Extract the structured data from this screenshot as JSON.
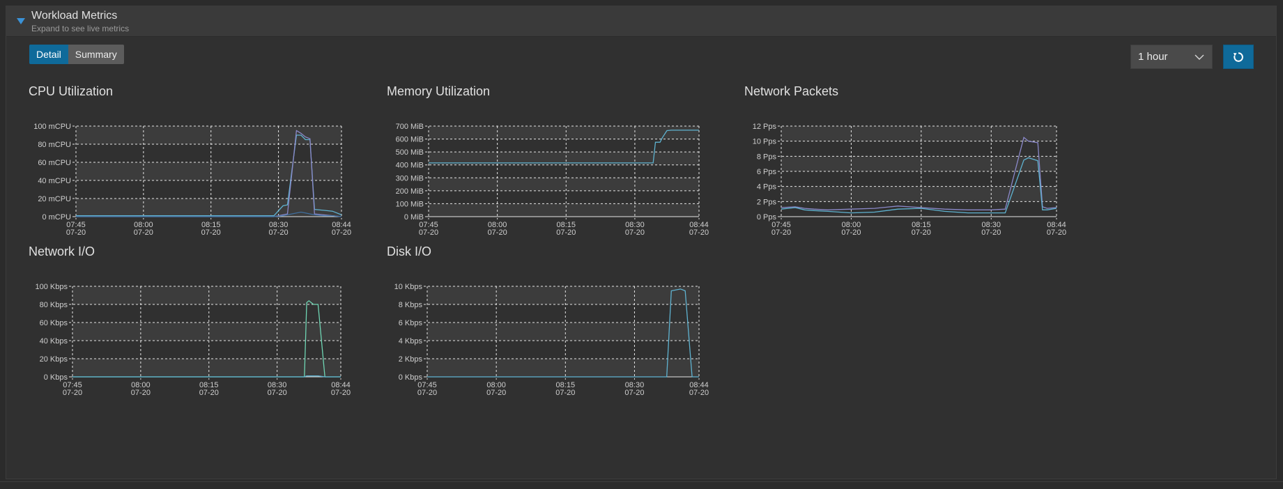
{
  "panel": {
    "title": "Workload Metrics",
    "subtitle": "Expand to see live metrics"
  },
  "view_toggle": {
    "detail": "Detail",
    "summary": "Summary"
  },
  "range_select": {
    "value": "1 hour"
  },
  "icons": {
    "caret": "caret-down-icon",
    "chevron": "chevron-down-icon",
    "refresh": "refresh-icon"
  },
  "colors": {
    "accent": "#0f6a9a",
    "series_blue": "#5fb3d1",
    "series_green": "#6fd6b4",
    "series_purple": "#8a88c8"
  },
  "charts": [
    {
      "title": "CPU Utilization",
      "yticks": [
        "100 mCPU",
        "80 mCPU",
        "60 mCPU",
        "40 mCPU",
        "20 mCPU",
        "0 mCPU"
      ],
      "xticks": [
        [
          "07:45",
          "07-20"
        ],
        [
          "08:00",
          "07-20"
        ],
        [
          "08:15",
          "07-20"
        ],
        [
          "08:30",
          "07-20"
        ],
        [
          "08:44",
          "07-20"
        ]
      ]
    },
    {
      "title": "Memory Utilization",
      "yticks": [
        "700 MiB",
        "600 MiB",
        "500 MiB",
        "400 MiB",
        "300 MiB",
        "200 MiB",
        "100 MiB",
        "0 MiB"
      ],
      "xticks": [
        [
          "07:45",
          "07-20"
        ],
        [
          "08:00",
          "07-20"
        ],
        [
          "08:15",
          "07-20"
        ],
        [
          "08:30",
          "07-20"
        ],
        [
          "08:44",
          "07-20"
        ]
      ]
    },
    {
      "title": "Network Packets",
      "yticks": [
        "12 Pps",
        "10 Pps",
        "8 Pps",
        "6 Pps",
        "4 Pps",
        "2 Pps",
        "0 Pps"
      ],
      "xticks": [
        [
          "07:45",
          "07-20"
        ],
        [
          "08:00",
          "07-20"
        ],
        [
          "08:15",
          "07-20"
        ],
        [
          "08:30",
          "07-20"
        ],
        [
          "08:44",
          "07-20"
        ]
      ]
    },
    {
      "title": "Network I/O",
      "yticks": [
        "100 Kbps",
        "80 Kbps",
        "60 Kbps",
        "40 Kbps",
        "20 Kbps",
        "0 Kbps"
      ],
      "xticks": [
        [
          "07:45",
          "07-20"
        ],
        [
          "08:00",
          "07-20"
        ],
        [
          "08:15",
          "07-20"
        ],
        [
          "08:30",
          "07-20"
        ],
        [
          "08:44",
          "07-20"
        ]
      ]
    },
    {
      "title": "Disk I/O",
      "yticks": [
        "10 Kbps",
        "8 Kbps",
        "6 Kbps",
        "4 Kbps",
        "2 Kbps",
        "0 Kbps"
      ],
      "xticks": [
        [
          "07:45",
          "07-20"
        ],
        [
          "08:00",
          "07-20"
        ],
        [
          "08:15",
          "07-20"
        ],
        [
          "08:30",
          "07-20"
        ],
        [
          "08:44",
          "07-20"
        ]
      ]
    }
  ],
  "chart_data": [
    {
      "type": "line",
      "title": "CPU Utilization",
      "x_minutes": [
        0,
        10,
        20,
        30,
        40,
        44,
        46,
        47,
        49,
        50,
        51,
        52,
        53,
        55,
        57,
        59
      ],
      "xtick_labels": [
        "07:45 07-20",
        "08:00 07-20",
        "08:15 07-20",
        "08:30 07-20",
        "08:44 07-20"
      ],
      "ylim": [
        0,
        100
      ],
      "grid": true,
      "series": [
        {
          "color": "#5fb3d1",
          "values": [
            1,
            1,
            1,
            1,
            1,
            1,
            12,
            13,
            90,
            90,
            85,
            85,
            8,
            7,
            6,
            2
          ]
        },
        {
          "color": "#8a88c8",
          "values": [
            0,
            0,
            0,
            0,
            0,
            0,
            2,
            3,
            95,
            92,
            88,
            86,
            3,
            2,
            1,
            0
          ]
        },
        {
          "color": "#3f6f9f",
          "values": [
            0,
            0,
            0,
            0,
            0,
            0,
            1,
            2,
            4,
            5,
            4,
            3,
            2,
            1,
            1,
            0
          ]
        }
      ]
    },
    {
      "type": "line",
      "title": "Memory Utilization",
      "x_minutes": [
        0,
        30,
        49,
        49.5,
        50.5,
        51,
        52,
        53,
        59
      ],
      "ylim": [
        0,
        700
      ],
      "grid": true,
      "series": [
        {
          "color": "#5fb3d1",
          "values": [
            415,
            415,
            415,
            575,
            575,
            610,
            665,
            668,
            668
          ]
        }
      ]
    },
    {
      "type": "line",
      "title": "Network Packets",
      "x_minutes": [
        0,
        3,
        5,
        7,
        10,
        15,
        20,
        25,
        30,
        35,
        40,
        45,
        48,
        52,
        53,
        55,
        56,
        57,
        59
      ],
      "ylim": [
        0,
        12
      ],
      "grid": true,
      "series": [
        {
          "color": "#8a88c8",
          "values": [
            1.2,
            1.3,
            1.1,
            1.0,
            0.9,
            1.0,
            1.1,
            1.4,
            1.2,
            1.0,
            0.9,
            0.9,
            1.0,
            10.5,
            10.0,
            9.8,
            1.3,
            1.1,
            1.2
          ]
        },
        {
          "color": "#5fb3d1",
          "values": [
            1.0,
            1.2,
            0.9,
            0.8,
            0.7,
            0.5,
            0.6,
            1.0,
            1.1,
            0.7,
            0.5,
            0.5,
            0.5,
            7.5,
            7.8,
            7.4,
            0.9,
            0.9,
            1.1
          ]
        }
      ]
    },
    {
      "type": "line",
      "title": "Network I/O",
      "x_minutes": [
        0,
        50,
        51,
        51.5,
        52,
        53,
        54,
        55.5,
        59
      ],
      "ylim": [
        0,
        100
      ],
      "grid": true,
      "series": [
        {
          "color": "#6fd6b4",
          "values": [
            0,
            0,
            0,
            82,
            84,
            80,
            80,
            0,
            0
          ]
        },
        {
          "color": "#5fb3d1",
          "values": [
            0,
            0,
            0,
            1,
            1,
            1,
            1,
            0,
            0
          ]
        }
      ]
    },
    {
      "type": "line",
      "title": "Disk I/O",
      "x_minutes": [
        0,
        50,
        52,
        53,
        55,
        56,
        57.5,
        59
      ],
      "ylim": [
        0,
        10
      ],
      "grid": true,
      "series": [
        {
          "color": "#5fb3d1",
          "values": [
            0,
            0,
            0,
            9.5,
            9.7,
            9.5,
            0,
            0
          ]
        }
      ]
    }
  ]
}
